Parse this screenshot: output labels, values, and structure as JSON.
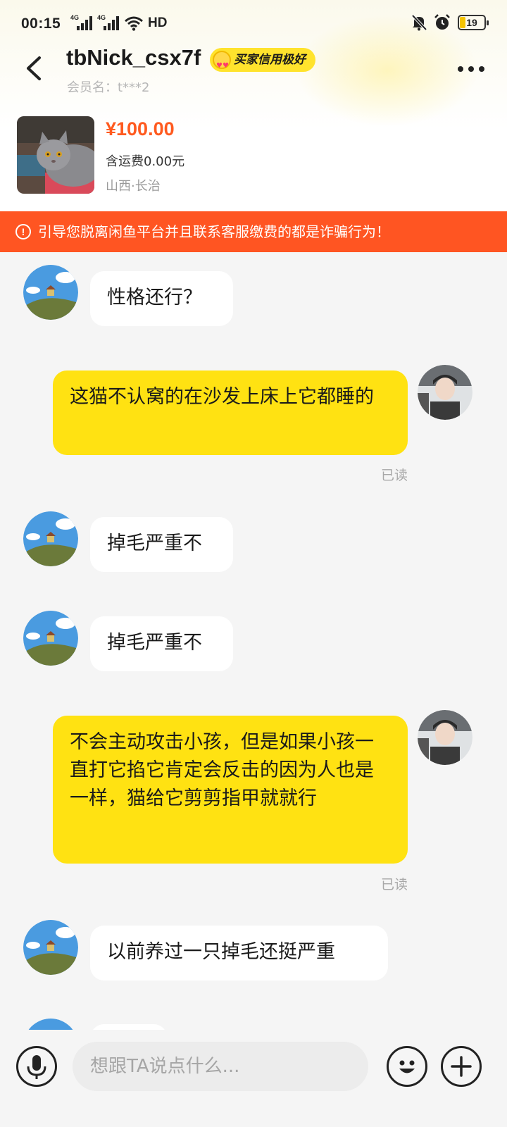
{
  "status_bar": {
    "time": "00:15",
    "signal1_label": "4G",
    "signal2_label": "4G",
    "hd_label": "HD",
    "battery": "19"
  },
  "header": {
    "nickname": "tbNick_csx7f",
    "credit_badge": "买家信用极好",
    "member_name": "会员名：t***2"
  },
  "product": {
    "price": "¥100.00",
    "shipping": "含运费0.00元",
    "location": "山西·长治"
  },
  "warning": {
    "text": "引导您脱离闲鱼平台并且联系客服缴费的都是诈骗行为！"
  },
  "messages": [
    {
      "from": "them",
      "text": "性格还行？"
    },
    {
      "from": "me",
      "text": "这猫不认窝的在沙发上床上它都睡的",
      "status": "已读"
    },
    {
      "from": "them",
      "text": "掉毛严重不"
    },
    {
      "from": "them",
      "text": "掉毛严重不"
    },
    {
      "from": "me",
      "text": "不会主动攻击小孩，但是如果小孩一直打它掐它肯定会反击的因为人也是一样，猫给它剪剪指甲就就行",
      "status": "已读"
    },
    {
      "from": "them",
      "text": "以前养过一只掉毛还挺严重"
    }
  ],
  "input": {
    "placeholder": "想跟TA说点什么..."
  },
  "icons": {
    "back": "back-arrow-icon",
    "more": "more-dots-icon",
    "voice": "microphone-icon",
    "emoji": "emoji-icon",
    "add": "plus-icon",
    "dnd": "bell-off-icon",
    "alarm": "alarm-icon",
    "wifi": "wifi-icon"
  },
  "colors": {
    "accent_yellow": "#ffe212",
    "price_orange": "#ff5a1f",
    "warning_bg": "#ff5522"
  }
}
